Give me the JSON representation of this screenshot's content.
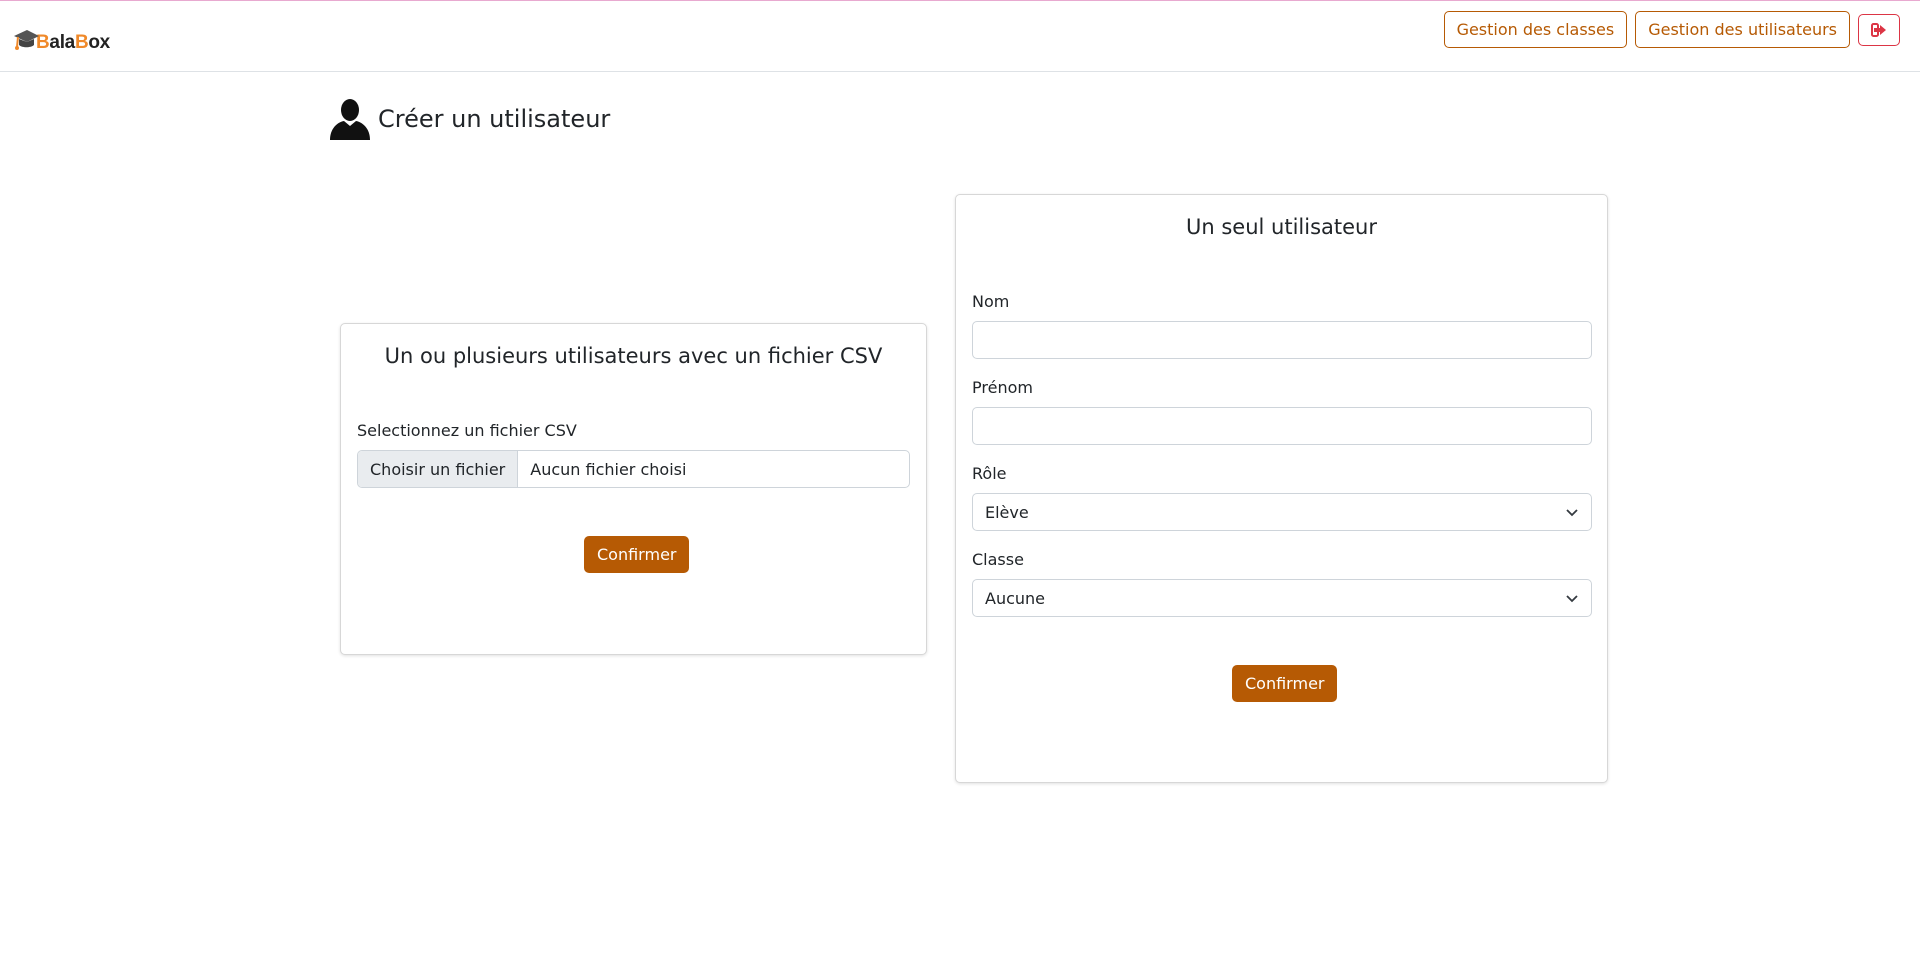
{
  "header": {
    "logo_text_parts": [
      "B",
      "ala",
      "B",
      "ox"
    ],
    "nav": {
      "classes_label": "Gestion des classes",
      "users_label": "Gestion des utilisateurs",
      "logout_icon": "sign-out-icon"
    }
  },
  "page": {
    "title": "Créer un utilisateur",
    "title_icon": "user-silhouette-icon"
  },
  "csv_card": {
    "title": "Un ou plusieurs utilisateurs avec un fichier CSV",
    "file_label": "Selectionnez un fichier CSV",
    "file_button": "Choisir un fichier",
    "file_status": "Aucun fichier choisi",
    "confirm_label": "Confirmer"
  },
  "single_card": {
    "title": "Un seul utilisateur",
    "nom_label": "Nom",
    "nom_value": "",
    "prenom_label": "Prénom",
    "prenom_value": "",
    "role_label": "Rôle",
    "role_value": "Elève",
    "classe_label": "Classe",
    "classe_value": "Aucune",
    "confirm_label": "Confirmer"
  },
  "colors": {
    "accent": "#b65a04",
    "logo_orange": "#f0892a",
    "danger": "#dc3545"
  }
}
